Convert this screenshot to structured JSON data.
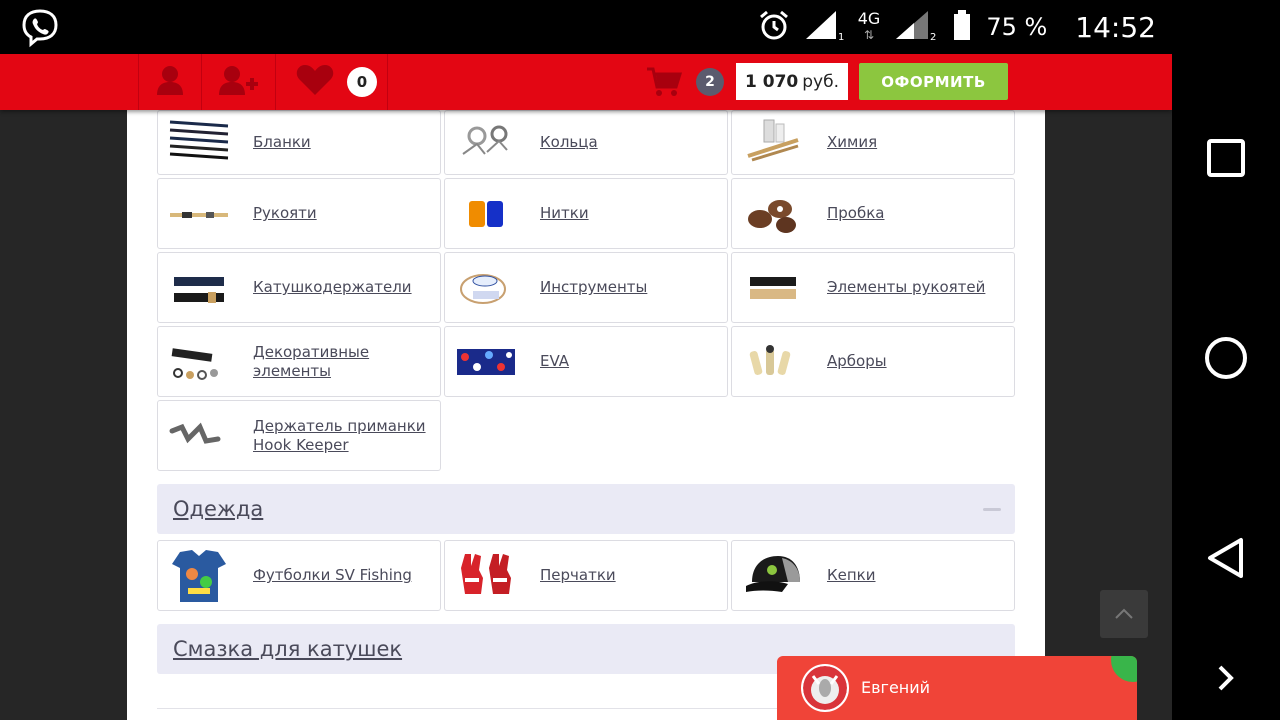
{
  "status_bar": {
    "network_type": "4G",
    "sim1": "1",
    "sim2": "2",
    "battery": "75 %",
    "time": "14:52"
  },
  "header": {
    "wishlist_count": "0",
    "cart_count": "2",
    "price_amount": "1 070",
    "price_currency": "руб.",
    "checkout_label": "ОФОРМИТЬ"
  },
  "categories": [
    {
      "label": "Бланки",
      "icon": "blank-rods-image"
    },
    {
      "label": "Кольца",
      "icon": "rod-rings-image"
    },
    {
      "label": "Химия",
      "icon": "chemistry-image"
    },
    {
      "label": "Рукояти",
      "icon": "handle-image"
    },
    {
      "label": "Нитки",
      "icon": "thread-spools-image"
    },
    {
      "label": "Пробка",
      "icon": "cork-image"
    },
    {
      "label": "Катушкодержатели",
      "icon": "reel-seat-image"
    },
    {
      "label": "Инструменты",
      "icon": "tools-image"
    },
    {
      "label": "Элементы рукоятей",
      "icon": "handle-elements-image"
    },
    {
      "label": "Декоративные элементы",
      "icon": "decor-elements-image"
    },
    {
      "label": "EVA",
      "icon": "eva-image"
    },
    {
      "label": "Арборы",
      "icon": "arbors-image"
    },
    {
      "label": "Держатель приманки Hook Keeper",
      "icon": "hook-keeper-image"
    }
  ],
  "section_clothing": {
    "title": "Одежда",
    "items": [
      {
        "label": "Футболки SV Fishing",
        "icon": "tshirt-image"
      },
      {
        "label": "Перчатки",
        "icon": "gloves-image"
      },
      {
        "label": "Кепки",
        "icon": "cap-image"
      }
    ]
  },
  "section_grease": {
    "title": "Смазка для катушек"
  },
  "chat": {
    "agent_name": "Евгений"
  },
  "colors": {
    "header_red": "#e30613",
    "checkout_green": "#8cc63f",
    "section_bg": "#eaeaf5",
    "chat_red": "#f04438"
  }
}
